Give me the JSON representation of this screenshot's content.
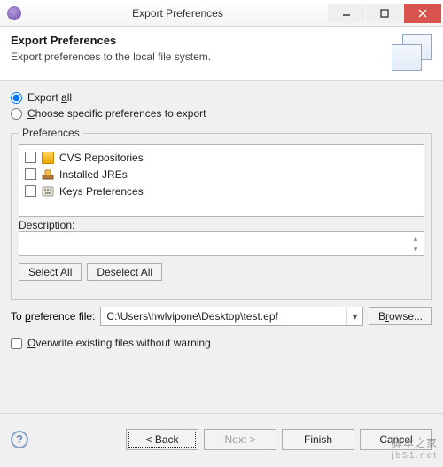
{
  "window": {
    "title": "Export Preferences"
  },
  "banner": {
    "heading": "Export Preferences",
    "subtext": "Export preferences to the local file system."
  },
  "options": {
    "export_all": "Export all",
    "choose_specific": "Choose specific preferences to export",
    "selected": "all"
  },
  "prefs_group": {
    "legend": "Preferences",
    "items": [
      {
        "label": "CVS Repositories",
        "icon": "cvs",
        "checked": false
      },
      {
        "label": "Installed JREs",
        "icon": "jre",
        "checked": false
      },
      {
        "label": "Keys Preferences",
        "icon": "keys",
        "checked": false
      }
    ],
    "description_label": "Description:",
    "description_value": "",
    "select_all": "Select All",
    "deselect_all": "Deselect All"
  },
  "file": {
    "label": "To preference file:",
    "value": "C:\\Users\\hwlvipone\\Desktop\\test.epf",
    "browse": "Browse..."
  },
  "overwrite": {
    "label": "Overwrite existing files without warning",
    "checked": false
  },
  "buttons": {
    "back": "< Back",
    "next": "Next >",
    "finish": "Finish",
    "cancel": "Cancel"
  },
  "watermark": {
    "line1": "脚本之家",
    "line2": "jb51.net"
  }
}
